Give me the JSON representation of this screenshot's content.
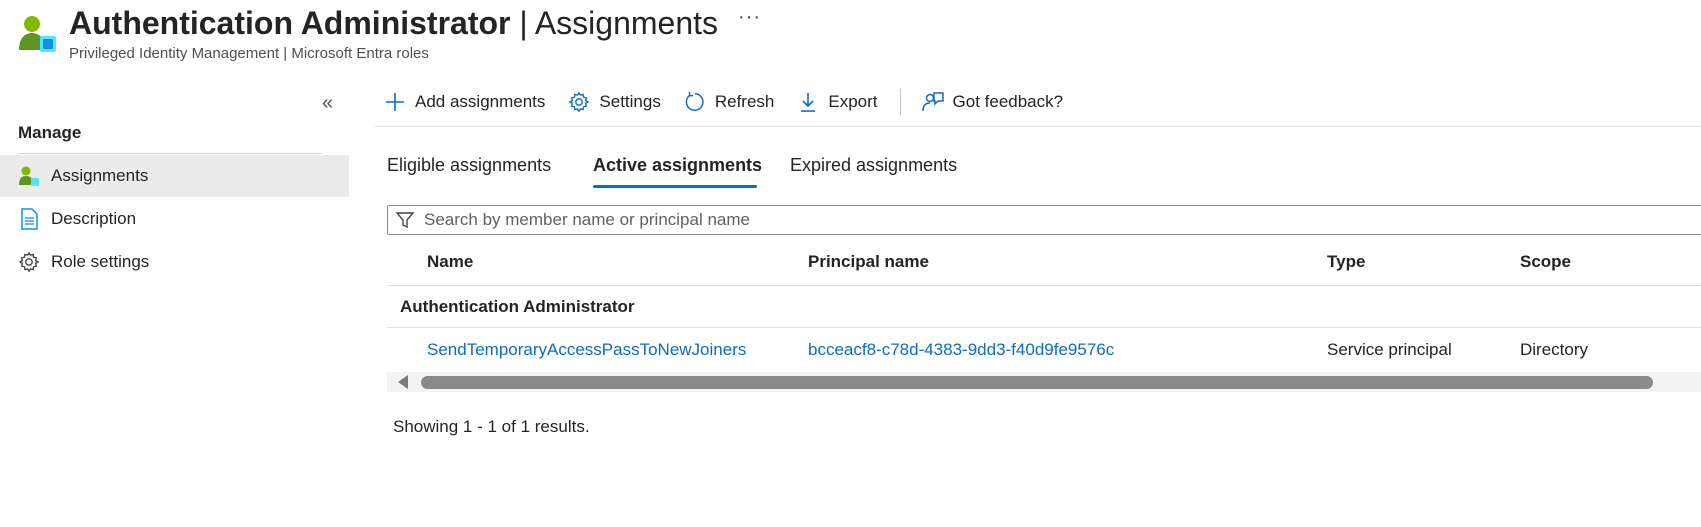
{
  "header": {
    "title_main": "Authentication Administrator",
    "title_sep": "|",
    "title_section": "Assignments",
    "subtitle": "Privileged Identity Management | Microsoft Entra roles",
    "more": "···"
  },
  "sidebar": {
    "collapse": "«",
    "section_title": "Manage",
    "items": [
      {
        "label": "Assignments",
        "icon": "user-group-icon",
        "active": true
      },
      {
        "label": "Description",
        "icon": "document-icon",
        "active": false
      },
      {
        "label": "Role settings",
        "icon": "gear-icon",
        "active": false
      }
    ]
  },
  "toolbar": {
    "add_label": "Add assignments",
    "settings_label": "Settings",
    "refresh_label": "Refresh",
    "export_label": "Export",
    "feedback_label": "Got feedback?"
  },
  "tabs": [
    {
      "label": "Eligible assignments",
      "active": false
    },
    {
      "label": "Active assignments",
      "active": true
    },
    {
      "label": "Expired assignments",
      "active": false
    }
  ],
  "search": {
    "placeholder": "Search by member name or principal name",
    "value": ""
  },
  "table": {
    "columns": [
      "Name",
      "Principal name",
      "Type",
      "Scope"
    ],
    "group_label": "Authentication Administrator",
    "rows": [
      {
        "name": "SendTemporaryAccessPassToNewJoiners",
        "principal": "bcceacf8-c78d-4383-9dd3-f40d9fe9576c",
        "type": "Service principal",
        "scope": "Directory"
      }
    ]
  },
  "footer": {
    "showing": "Showing 1 - 1 of 1 results."
  },
  "colors": {
    "accent": "#0f6cbd",
    "link": "#0f6cbd",
    "active_nav_bg": "#ebebeb"
  }
}
